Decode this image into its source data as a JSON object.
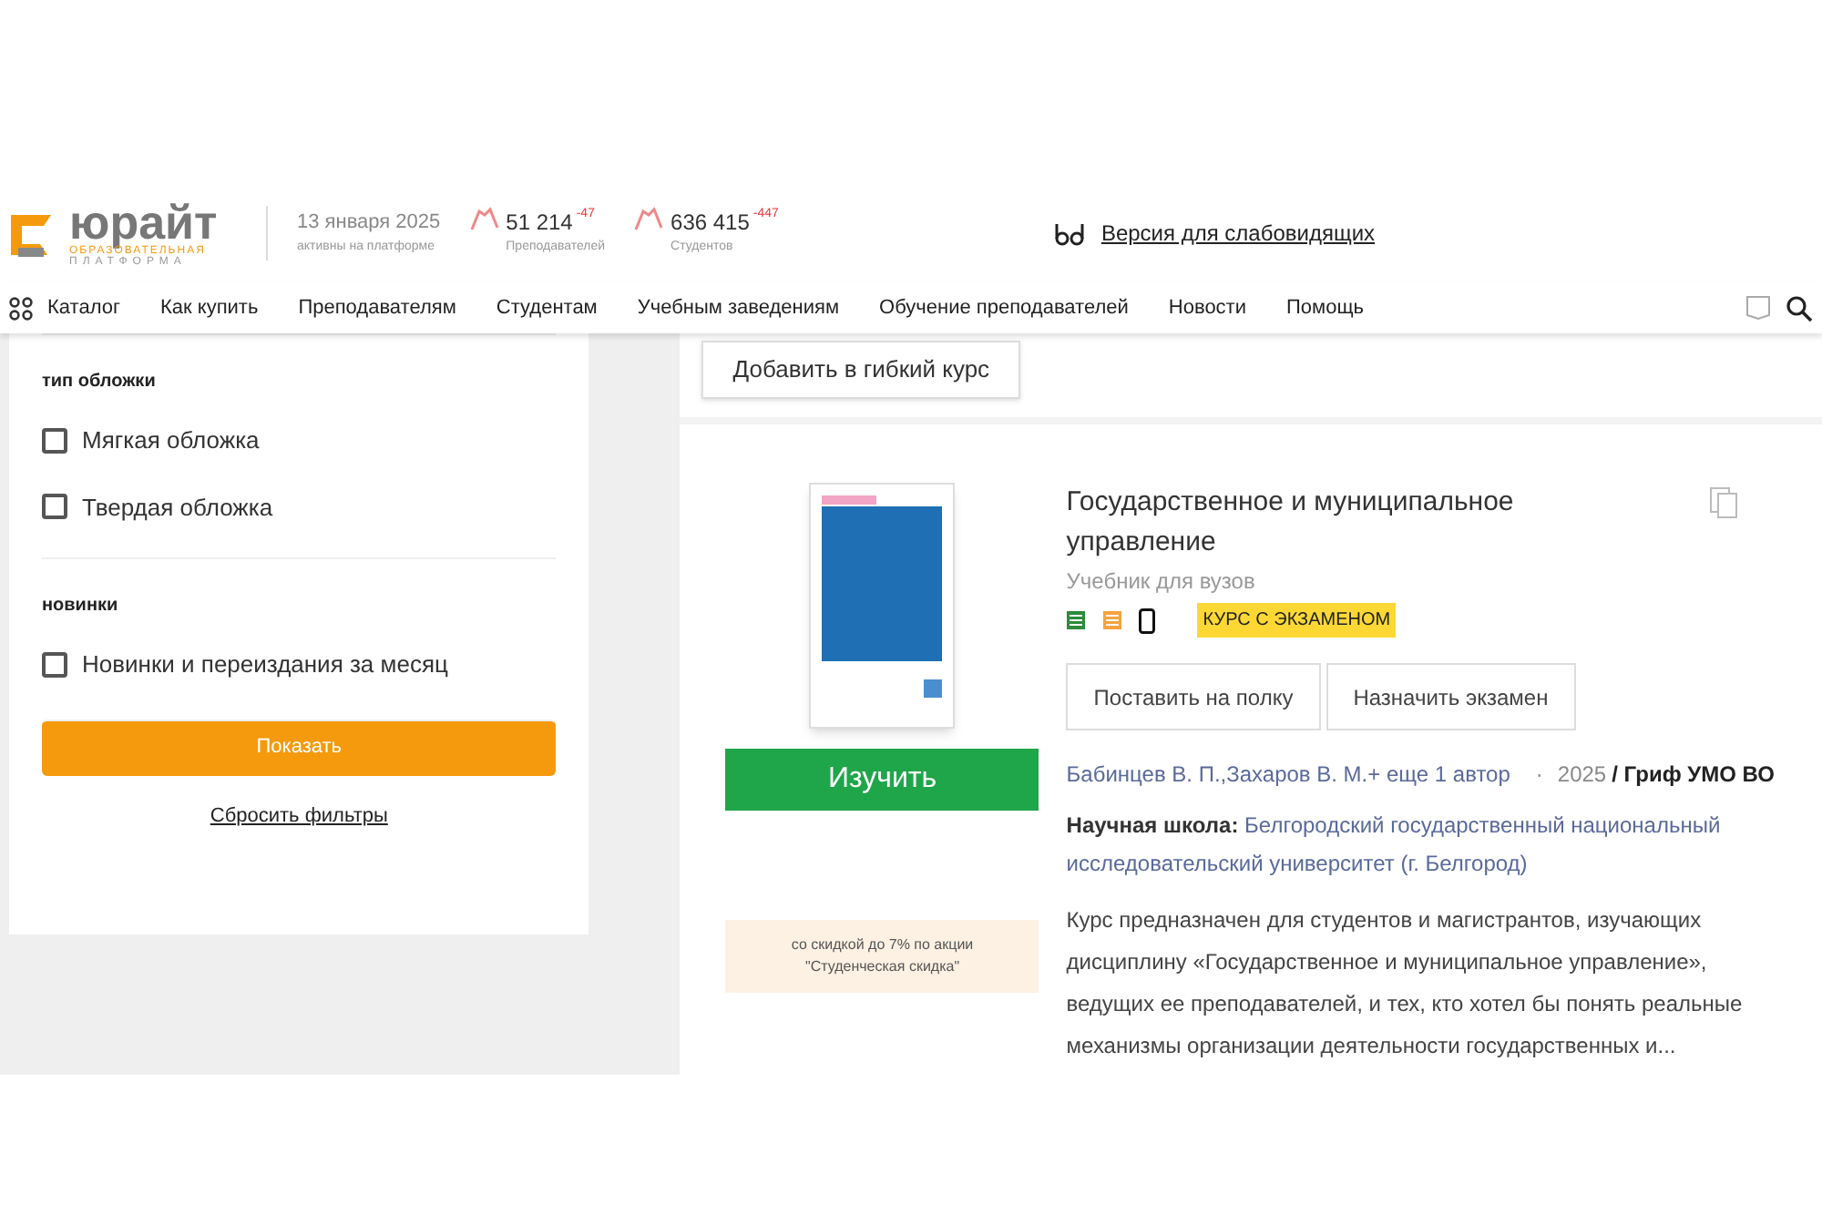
{
  "header": {
    "logo": {
      "name": "юрайт",
      "tagline_1": "ОБРАЗОВАТЕЛЬНАЯ",
      "tagline_2": "ПЛАТФОРМА"
    },
    "date": "13 января 2025",
    "date_caption": "активны на платформе",
    "stats": [
      {
        "value": "51 214",
        "delta": "-47",
        "caption": "Преподавателей"
      },
      {
        "value": "636 415",
        "delta": "-447",
        "caption": "Студентов"
      }
    ],
    "accessibility_link": "Версия для слабовидящих"
  },
  "nav": {
    "catalog": "Каталог",
    "items": [
      "Как купить",
      "Преподавателям",
      "Студентам",
      "Учебным заведениям",
      "Обучение преподавателей",
      "Новости",
      "Помощь"
    ]
  },
  "sidebar": {
    "groups": [
      {
        "title": "тип обложки",
        "options": [
          {
            "label": "Мягкая обложка",
            "checked": false
          },
          {
            "label": "Твердая обложка",
            "checked": false
          }
        ]
      },
      {
        "title": "новинки",
        "options": [
          {
            "label": "Новинки и переиздания за месяц",
            "checked": false
          }
        ]
      }
    ],
    "apply_button": "Показать",
    "reset_link": "Сбросить фильтры"
  },
  "previous_item": {
    "button": "Добавить в гибкий курс"
  },
  "book": {
    "title": "Государственное и муниципальное управление",
    "type": "Учебник для вузов",
    "badge": "КУРС С ЭКЗАМЕНОМ",
    "study_button": "Изучить",
    "discount_line_1": "со скидкой до 7% по акции",
    "discount_line_2": "\"Студенческая скидка\"",
    "actions": [
      "Поставить на полку",
      "Назначить экзамен"
    ],
    "authors": "Бабинцев В. П.,Захаров В. М.",
    "more_authors": "+ еще 1 автор",
    "separator": "·",
    "year": "2025",
    "stamp": "/ Гриф УМО ВО",
    "school_label": "Научная школа:",
    "school": "Белгородский государственный национальный исследовательский университет (г. Белгород)",
    "description": "Курс предназначен для студентов и магистрантов, изучающих дисциплину «Государственное и муниципальное управление», ведущих ее преподавателей, и тех, кто хотел бы понять реальные механизмы организации деятельности государственных и..."
  }
}
